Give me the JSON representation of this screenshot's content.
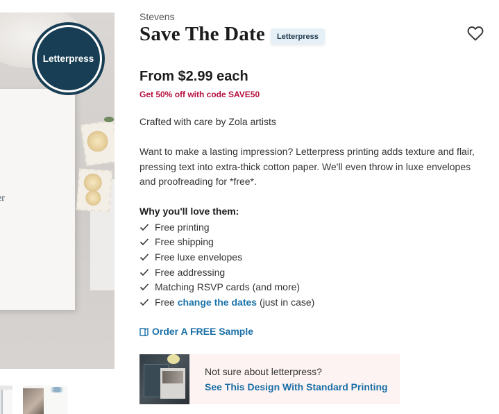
{
  "gallery": {
    "badge": "Letterpress",
    "card_fragment": "er"
  },
  "product": {
    "brand": "Stevens",
    "title": "Save The Date",
    "tag": "Letterpress",
    "price": "From $2.99 each",
    "promo": "Get 50% off with code SAVE50",
    "crafted": "Crafted with care by Zola artists",
    "description": "Want to make a lasting impression? Letterpress printing adds texture and flair, pressing text into extra-thick cotton paper. We'll even throw in luxe envelopes and proofreading for *free*.",
    "why_heading": "Why you'll love them:",
    "features": [
      "Free printing",
      "Free shipping",
      "Free luxe envelopes",
      "Free addressing",
      "Matching RSVP cards (and more)"
    ],
    "last_feature": {
      "prefix": "Free",
      "link": "change the dates",
      "suffix": "(just in case)"
    },
    "sample_link": "Order A FREE Sample",
    "alt_prompt": {
      "question": "Not sure about letterpress?",
      "link": "See This Design With Standard Printing"
    }
  },
  "icons": {
    "favorite": "heart-outline-icon",
    "check": "check-icon",
    "sample": "sample-card-icon"
  },
  "colors": {
    "badge_bg": "#173e54",
    "promo_red": "#b5123f",
    "link_blue": "#1a6fa6",
    "pill_bg": "#e5f0f6",
    "promo_box_bg": "#fdf3f2"
  }
}
